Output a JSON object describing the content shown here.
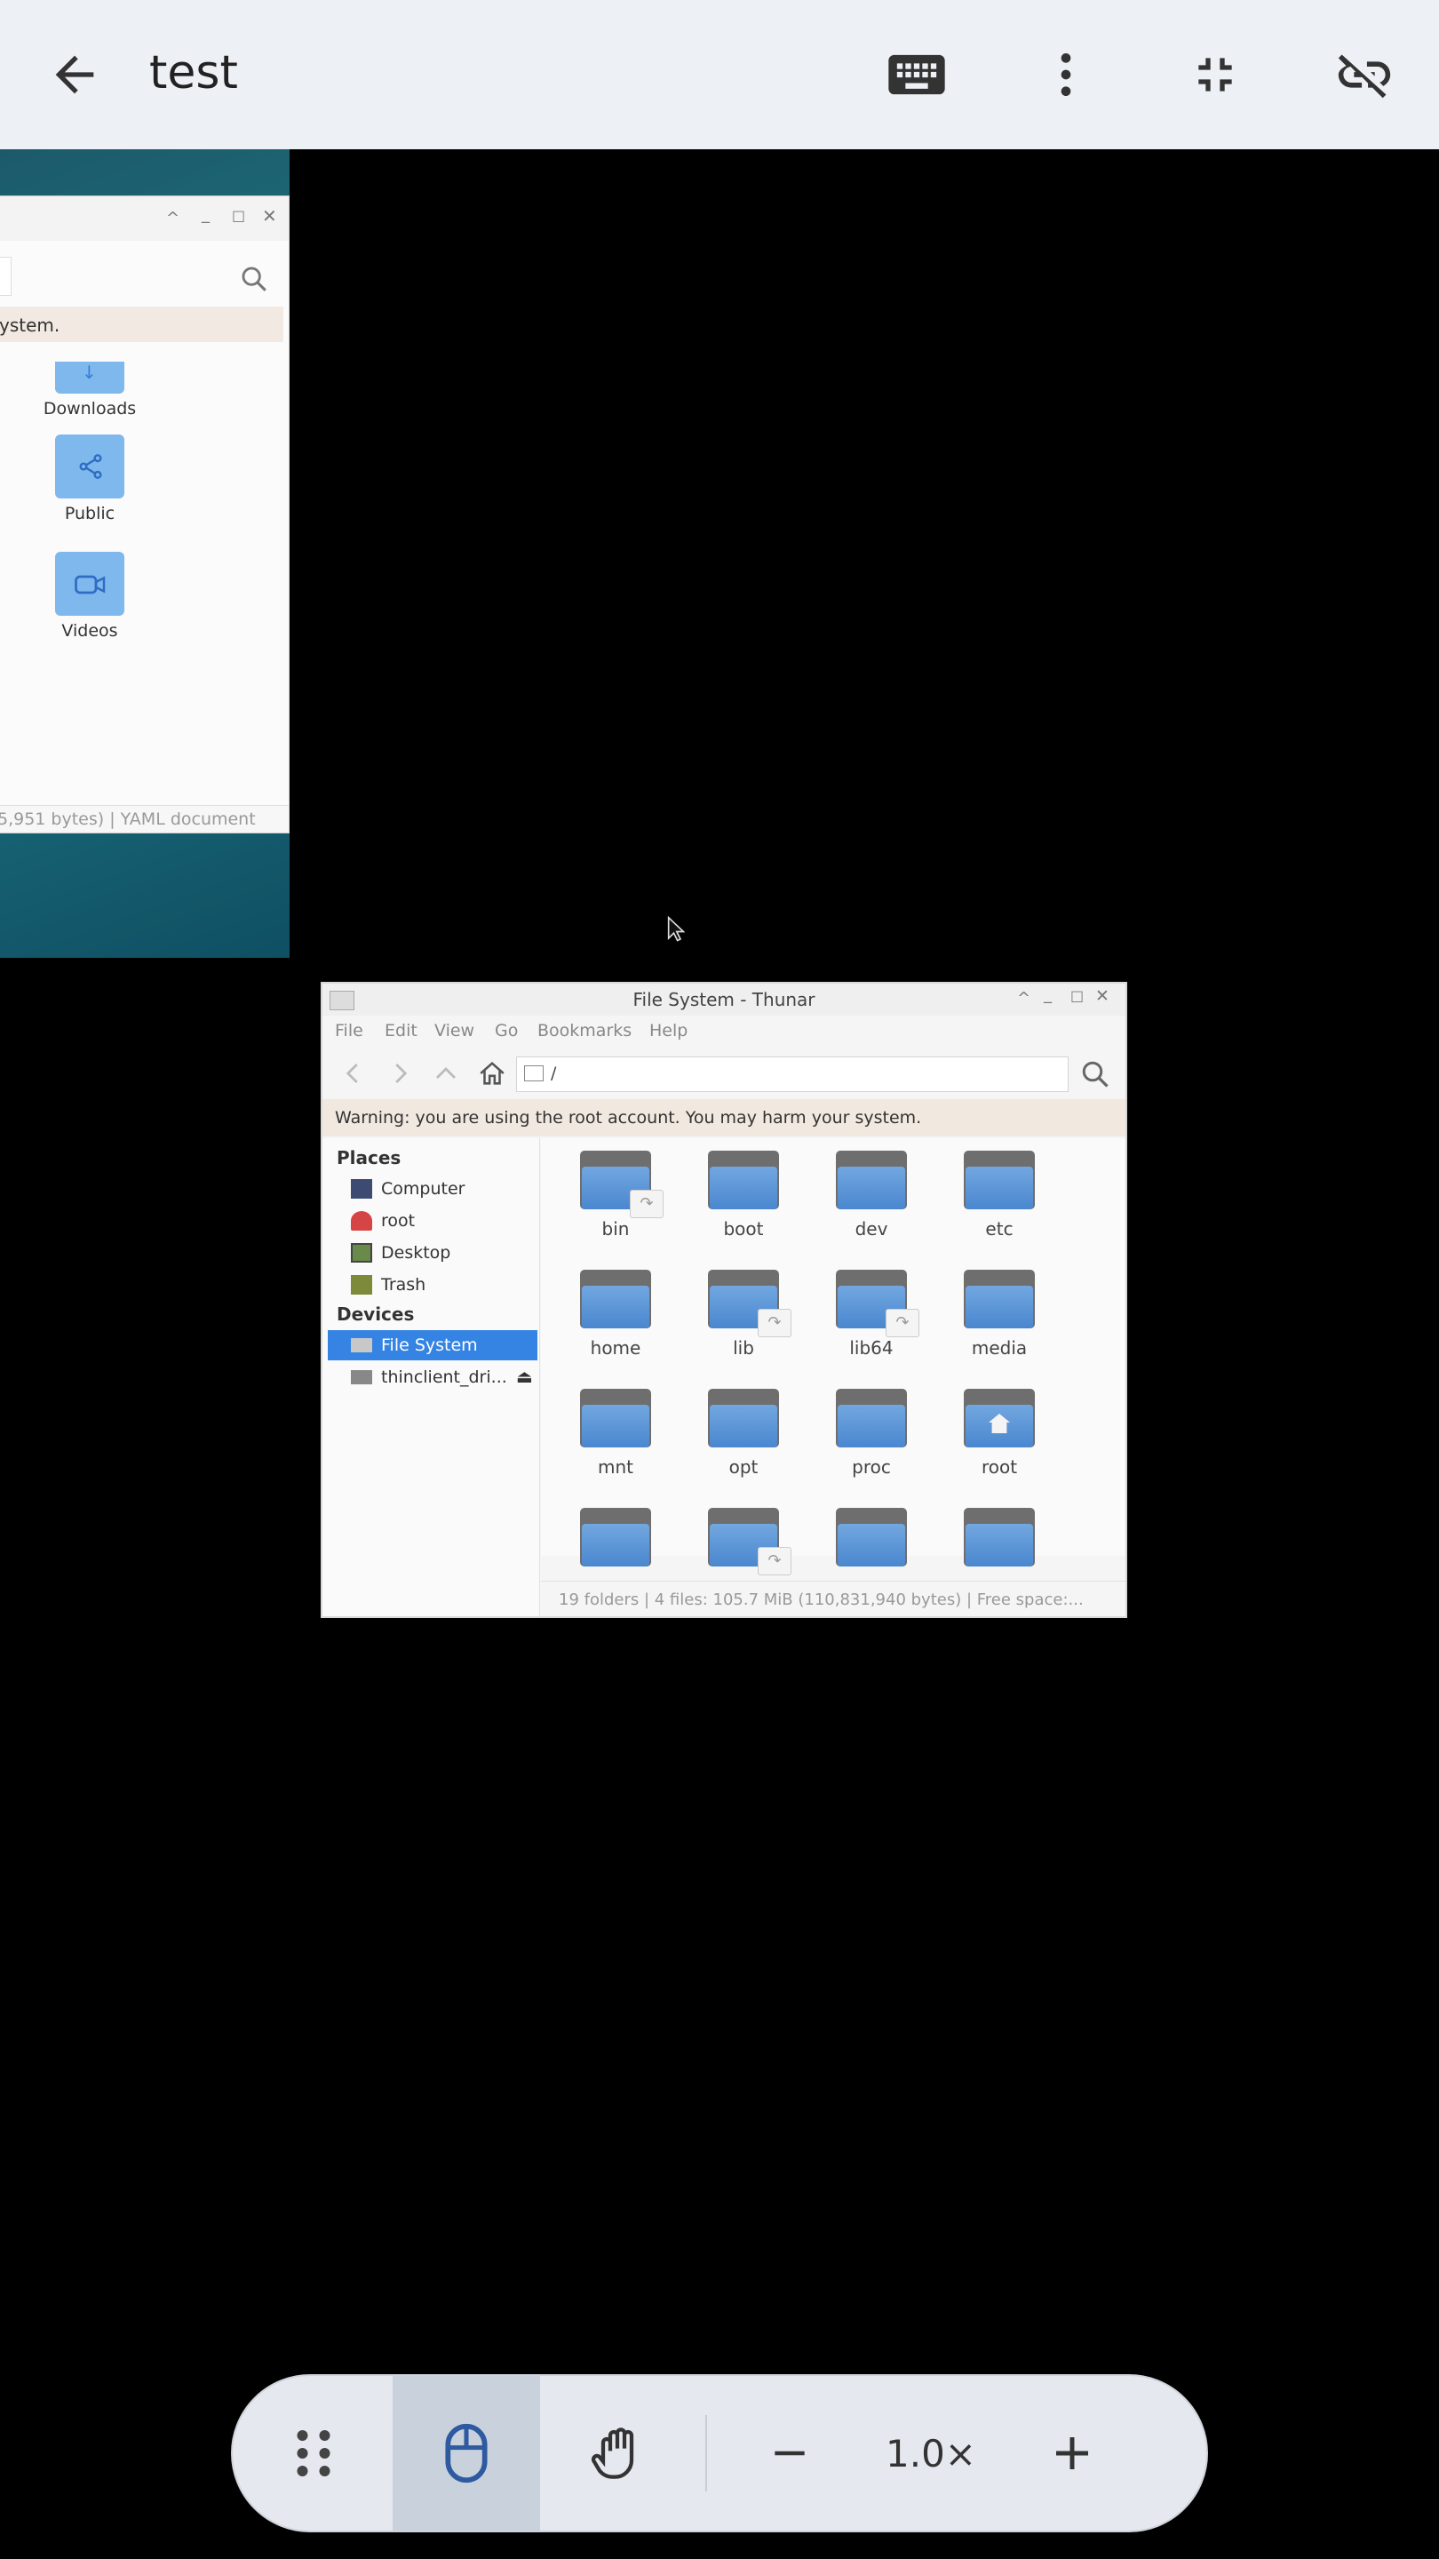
{
  "app": {
    "title": "test",
    "back_icon": "arrow-left-icon",
    "actions": [
      "keyboard-icon",
      "more-vert-icon",
      "fullscreen-exit-icon",
      "link-off-icon"
    ]
  },
  "bg_window": {
    "warning_fragment": "ystem.",
    "folders": [
      "Downloads",
      "Public",
      "Videos"
    ],
    "status_fragment": "5,951 bytes)  |  YAML document"
  },
  "thunar": {
    "title": "File System - Thunar",
    "menu": [
      "File",
      "Edit",
      "View",
      "Go",
      "Bookmarks",
      "Help"
    ],
    "location": "/",
    "warning": "Warning: you are using the root account. You may harm your system.",
    "places_header": "Places",
    "places": [
      "Computer",
      "root",
      "Desktop",
      "Trash"
    ],
    "devices_header": "Devices",
    "devices": [
      "File System",
      "thinclient_dri..."
    ],
    "folders": [
      {
        "name": "bin",
        "link": true
      },
      {
        "name": "boot",
        "link": false
      },
      {
        "name": "dev",
        "link": false
      },
      {
        "name": "etc",
        "link": false
      },
      {
        "name": "home",
        "link": false
      },
      {
        "name": "lib",
        "link": true
      },
      {
        "name": "lib64",
        "link": true
      },
      {
        "name": "media",
        "link": false
      },
      {
        "name": "mnt",
        "link": false
      },
      {
        "name": "opt",
        "link": false
      },
      {
        "name": "proc",
        "link": false
      },
      {
        "name": "root",
        "link": false
      },
      {
        "name": "",
        "link": false
      },
      {
        "name": "",
        "link": true
      },
      {
        "name": "",
        "link": false
      },
      {
        "name": "",
        "link": false
      }
    ],
    "status": "19 folders  |  4 files: 105.7 MiB (110,831,940 bytes)  |  Free space:..."
  },
  "controls": {
    "zoom": "1.0×",
    "buttons": [
      "drag-handle-icon",
      "mouse-icon",
      "hand-icon",
      "minus-icon",
      "plus-icon"
    ]
  },
  "colors": {
    "accent": "#3584e4",
    "folder": "#5b95d6",
    "header_bg": "#edf0f4",
    "control_bg": "#e5e8ee"
  }
}
